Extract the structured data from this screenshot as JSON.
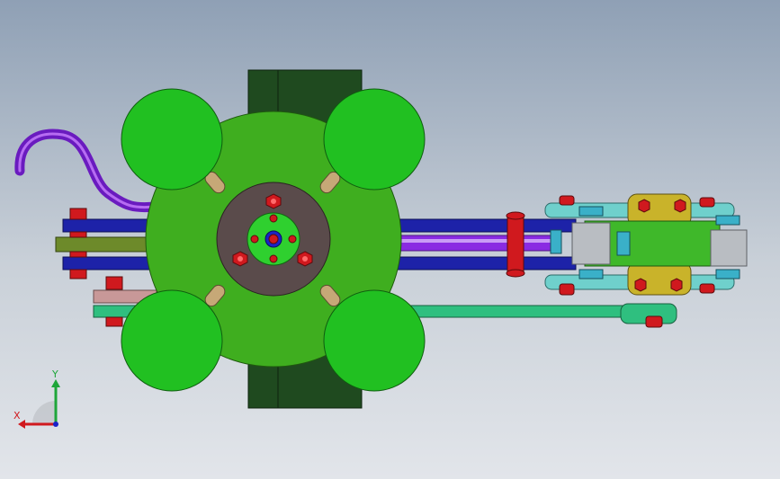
{
  "viewport": {
    "background_top": "#8fa0b5",
    "background_bottom": "#e2e5ea"
  },
  "colors": {
    "main_plate": "#3fae1f",
    "corner_wheel": "#21c021",
    "hub": "#5a4b4b",
    "inner_hub": "#2fd02f",
    "bolt": "#d0191e",
    "center_pin": "#1a22c8",
    "arm": "#1d22a8",
    "olive_link": "#6d8a2a",
    "pink_link": "#c89898",
    "rod": "#8a2be2",
    "teal_bar": "#2fbf7f",
    "base_block": "#1f4a1f",
    "end_block": "#b9bdc2",
    "yellow_plate": "#c9b32a",
    "cyan_plate": "#6fd0cc"
  },
  "triad": {
    "x_label": "X",
    "y_label": "Y",
    "x_color": "#d0191e",
    "y_color": "#1ea63a",
    "z_color": "#1a22c8"
  }
}
